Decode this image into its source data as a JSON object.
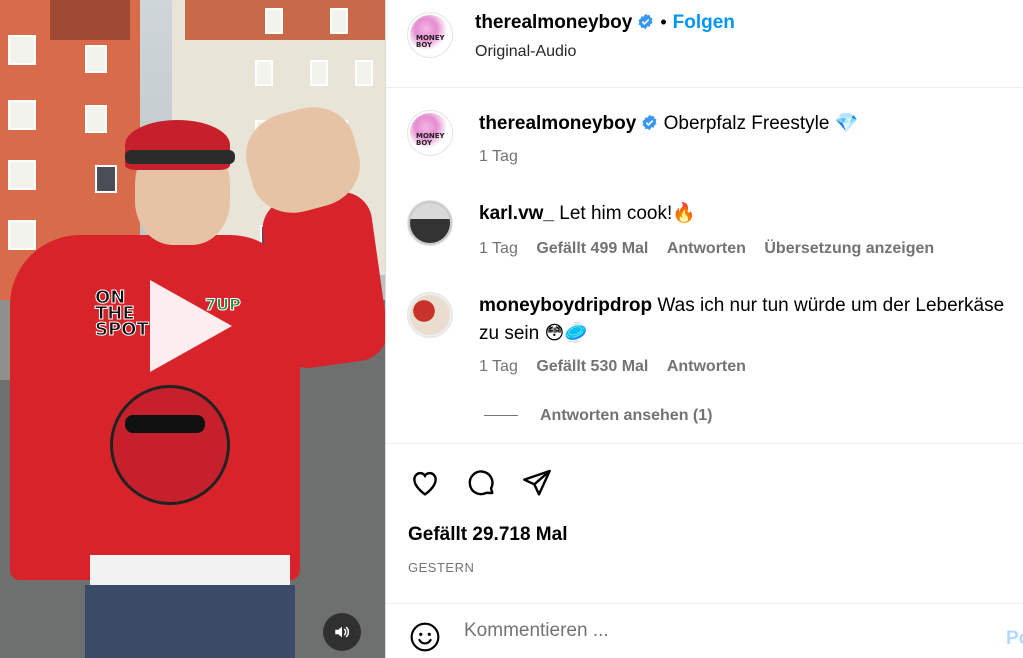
{
  "post": {
    "author": "therealmoneyboy",
    "follow_label": "Folgen",
    "separator": "•",
    "audio": "Original-Audio",
    "avatar_text": "MONEY BOY"
  },
  "video": {
    "play_icon": "play-icon",
    "mute_icon": "speaker-icon",
    "hoodie_print": [
      "ON THE SPOT",
      "7UP"
    ]
  },
  "caption": {
    "author": "therealmoneyboy",
    "text": "Oberpfalz Freestyle 💎",
    "time": "1 Tag"
  },
  "comments": [
    {
      "user": "karl.vw_",
      "text": "Let him cook!🔥",
      "time": "1 Tag",
      "likes": "Gefällt 499 Mal",
      "reply": "Antworten",
      "translate": "Übersetzung anzeigen"
    },
    {
      "user": "moneyboydripdrop",
      "text_line1": "Was ich nur tun würde um der Leberkäse",
      "text_line2": "zu sein 😳🥏",
      "time": "1 Tag",
      "likes": "Gefällt 530 Mal",
      "reply": "Antworten",
      "view_replies": "Antworten ansehen (1)"
    }
  ],
  "actions": {
    "icons": [
      "heart-icon",
      "comment-icon",
      "share-icon"
    ],
    "likes": "Gefällt 29.718 Mal",
    "date": "GESTERN"
  },
  "comment_box": {
    "placeholder": "Kommentieren ...",
    "post_label": "Po"
  },
  "colors": {
    "accent": "#0095f6",
    "verified": "#3897f0",
    "muted": "#737373"
  }
}
